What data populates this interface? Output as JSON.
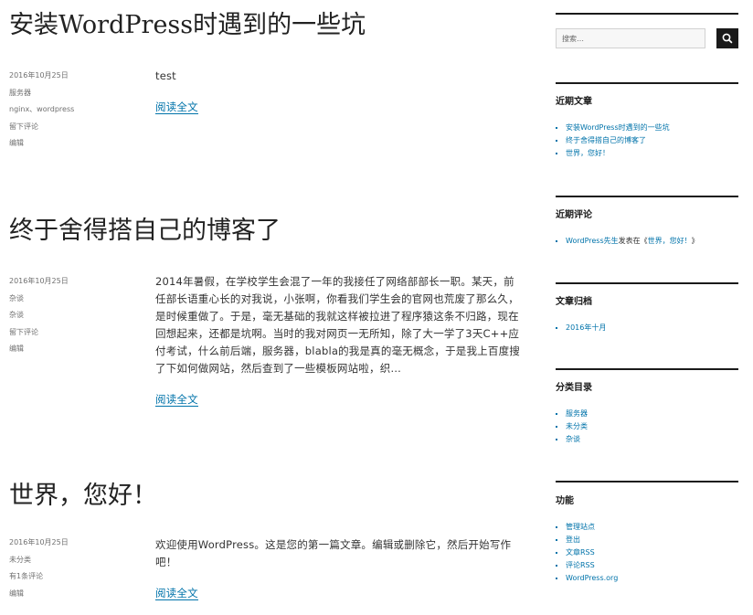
{
  "posts": [
    {
      "title": "安装WordPress时遇到的一些坑",
      "date": "2016年10月25日",
      "category": "服务器",
      "tags": "nginx、wordpress",
      "comments": "留下评论",
      "edit": "编辑",
      "content": "test",
      "read_more": "阅读全文"
    },
    {
      "title": "终于舍得搭自己的博客了",
      "date": "2016年10月25日",
      "category": "杂谈",
      "tags": "杂谈",
      "comments": "留下评论",
      "edit": "编辑",
      "content": "2014年暑假，在学校学生会混了一年的我接任了网络部部长一职。某天，前任部长语重心长的对我说，小张啊，你看我们学生会的官网也荒废了那么久，是时候重做了。于是，毫无基础的我就这样被拉进了程序猿这条不归路，现在回想起来，还都是坑啊。当时的我对网页一无所知，除了大一学了3天C++应付考试，什么前后端，服务器，blabla的我是真的毫无概念，于是我上百度搜了下如何做网站，然后查到了一些模板网站啦，织…",
      "read_more": "阅读全文"
    },
    {
      "title": "世界，您好！",
      "date": "2016年10月25日",
      "category": "未分类",
      "comments": "有1条评论",
      "edit": "编辑",
      "content": "欢迎使用WordPress。这是您的第一篇文章。编辑或删除它，然后开始写作吧！",
      "read_more": "阅读全文"
    }
  ],
  "sidebar": {
    "search": {
      "placeholder": "搜索…",
      "icon": "search-icon"
    },
    "recent_posts": {
      "title": "近期文章",
      "items": [
        "安装WordPress时遇到的一些坑",
        "终于舍得搭自己的博客了",
        "世界，您好！"
      ]
    },
    "recent_comments": {
      "title": "近期评论",
      "author": "WordPress先生",
      "connector": "发表在《",
      "post": "世界，您好！",
      "close": "》"
    },
    "archives": {
      "title": "文章归档",
      "items": [
        "2016年十月"
      ]
    },
    "categories": {
      "title": "分类目录",
      "items": [
        "服务器",
        "未分类",
        "杂谈"
      ]
    },
    "meta": {
      "title": "功能",
      "items": [
        "管理站点",
        "登出",
        "文章RSS",
        "评论RSS",
        "WordPress.org"
      ]
    }
  },
  "colors": {
    "link": "#0073aa",
    "text": "#333333",
    "meta": "#707070",
    "rule": "#1a1a1a"
  }
}
